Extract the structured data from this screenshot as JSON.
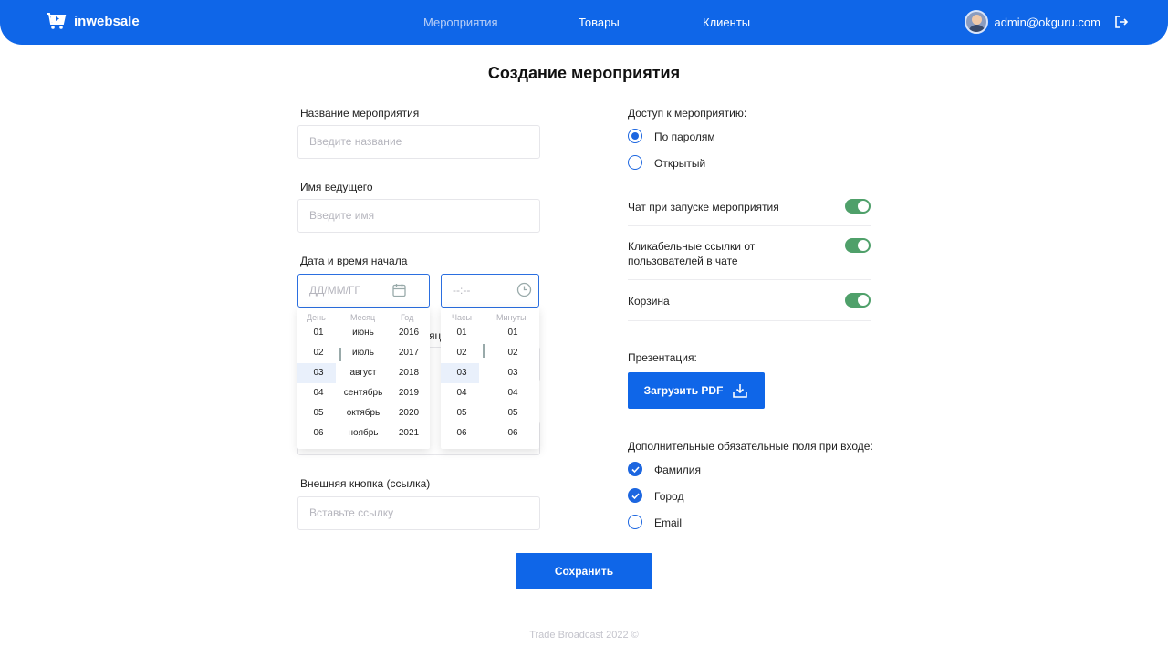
{
  "header": {
    "logo_text": "inwebsale",
    "nav": [
      "Мероприятия",
      "Товары",
      "Клиенты"
    ],
    "user_email": "admin@okguru.com"
  },
  "page_title": "Создание мероприятия",
  "form": {
    "event_name": {
      "label": "Название мероприятия",
      "placeholder": "Введите название"
    },
    "host_name": {
      "label": "Имя ведущего",
      "placeholder": "Введите имя"
    },
    "start_datetime": {
      "label": "Дата и время начала",
      "date_placeholder": "ДД/ММ/ГГ",
      "time_placeholder": "--:--"
    },
    "hidden_label_fragment": "яц",
    "external_button": {
      "label": "Внешняя кнопка (ссылка)",
      "placeholder": "Вставьте ссылку"
    }
  },
  "date_picker": {
    "headers": [
      "День",
      "Месяц",
      "Год"
    ],
    "days": [
      "01",
      "02",
      "03",
      "04",
      "05",
      "06"
    ],
    "months": [
      "июнь",
      "июль",
      "август",
      "сентябрь",
      "октябрь",
      "ноябрь"
    ],
    "years": [
      "2016",
      "2017",
      "2018",
      "2019",
      "2020",
      "2021"
    ],
    "selected_day": "03"
  },
  "time_picker": {
    "headers": [
      "Часы",
      "Минуты"
    ],
    "hours": [
      "01",
      "02",
      "03",
      "04",
      "05",
      "06"
    ],
    "minutes": [
      "01",
      "02",
      "03",
      "04",
      "05",
      "06"
    ],
    "selected_hour": "03"
  },
  "access": {
    "label": "Доступ к мероприятию:",
    "options": [
      {
        "label": "По паролям",
        "selected": true
      },
      {
        "label": "Открытый",
        "selected": false
      }
    ]
  },
  "toggles": [
    {
      "label": "Чат при запуске мероприятия",
      "on": true
    },
    {
      "label_line1": "Кликабельные ссылки от",
      "label_line2": "пользователей в чате",
      "on": true
    },
    {
      "label": "Корзина",
      "on": true
    }
  ],
  "presentation": {
    "label": "Презентация:",
    "button": "Загрузить PDF"
  },
  "extra_fields": {
    "label": "Дополнительные обязательные поля при входе:",
    "options": [
      {
        "label": "Фамилия",
        "checked": true
      },
      {
        "label": "Город",
        "checked": true
      },
      {
        "label": "Email",
        "checked": false
      }
    ]
  },
  "save_button": "Сохранить",
  "footer": "Trade Broadcast 2022 ©",
  "colors": {
    "primary": "#0f66e8",
    "toggle_on": "#4fa06a"
  }
}
